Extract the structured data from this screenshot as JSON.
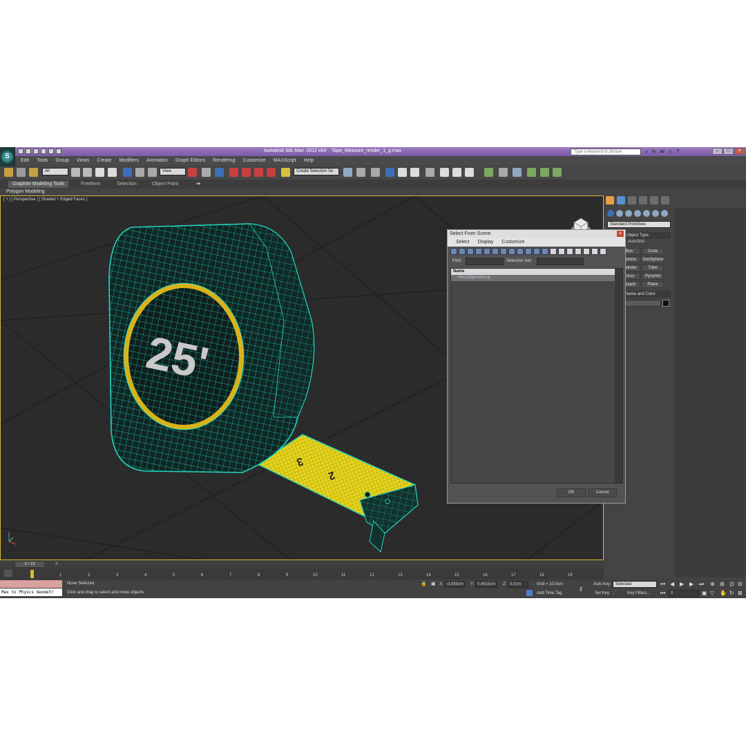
{
  "window": {
    "title": "Autodesk 3ds Max  2012 x64    Tape_Measure_render_1_g.max",
    "search_placeholder": "Type a keyword or phrase",
    "app_logo": "3ds-max-logo"
  },
  "menu": [
    "Edit",
    "Tools",
    "Group",
    "Views",
    "Create",
    "Modifiers",
    "Animation",
    "Graph Editors",
    "Rendering",
    "Customize",
    "MAXScript",
    "Help"
  ],
  "toolbar": {
    "selection_filter": "All",
    "reference_coord": "View",
    "named_selection_set": "Create Selection Se"
  },
  "ribbon": {
    "tabs": [
      "Graphite Modeling Tools",
      "Freeform",
      "Selection",
      "Object Paint"
    ],
    "panel": "Polygon Modeling"
  },
  "viewport": {
    "label": "[ + ] [ Perspective ] [ Shaded + Edged Faces ]",
    "model_text": "25'",
    "tape_numbers": [
      "3",
      "2"
    ]
  },
  "command_panel": {
    "primitive_type": "Standard Primitives",
    "object_type_title": "Object Type",
    "autogrid": "AutoGrid",
    "buttons": [
      "Box",
      "Cone",
      "Sphere",
      "GeoSphere",
      "Cylinder",
      "Tube",
      "Torus",
      "Pyramid",
      "Teapot",
      "Plane"
    ],
    "name_color_title": "Name and Color"
  },
  "dialog": {
    "title": "Select From Scene",
    "menu": [
      "Select",
      "Display",
      "Customize"
    ],
    "find_label": "Find:",
    "selection_set_label": "Selection Set:",
    "column_name": "Name",
    "rows": [
      "HeroObjectGroup"
    ],
    "ok": "OK",
    "cancel": "Cancel"
  },
  "timeline": {
    "frame_display": "0 / 19",
    "ticks": [
      "1",
      "2",
      "3",
      "4",
      "5",
      "6",
      "7",
      "8",
      "9",
      "10",
      "11",
      "12",
      "13",
      "14",
      "15",
      "16",
      "17",
      "18",
      "19"
    ]
  },
  "status": {
    "maxscript_text": "Max to Physcs Geometr",
    "selection": "None Selected",
    "prompt": "Click and drag to select and move objects",
    "x_label": "X:",
    "x": "-0,883cm",
    "y_label": "Y:",
    "y": "0,4615cm",
    "z_label": "Z:",
    "z": "0,0cm",
    "grid": "Grid = 10,0cm",
    "add_time_tag": "Add Time Tag",
    "auto_key": "Auto Key",
    "auto_key_mode": "Selected",
    "set_key": "Set Key",
    "key_filters": "Key Filters...",
    "current_frame": "0"
  },
  "colors": {
    "title_bar": "#8a6ab4",
    "viewport_bg": "#2b2b2b",
    "wire": "#23d6c0",
    "ring": "#d9b21a",
    "tape": "#e5d41a",
    "viewport_border": "#d8b838"
  }
}
